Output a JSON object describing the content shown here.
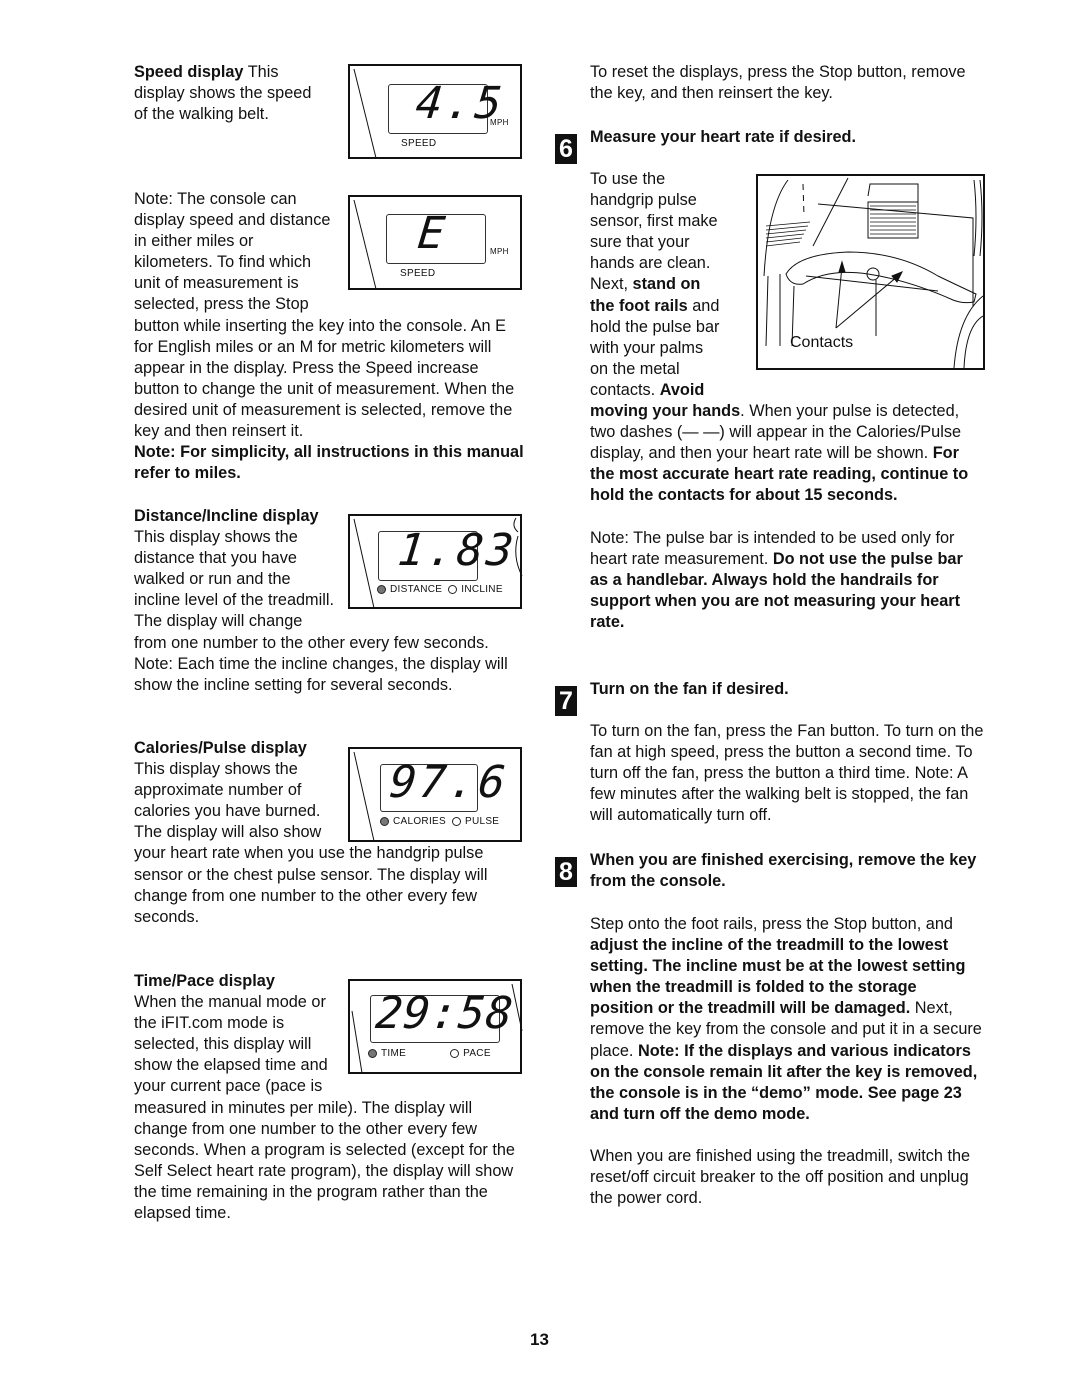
{
  "left_column": {
    "speed": {
      "title": "Speed display",
      "body": " This display shows the speed of the walking belt.",
      "display_value": "4.5",
      "display_unit": "MPH",
      "display_label": "SPEED"
    },
    "units_note": {
      "text": "Note: The console can display speed and distance in either miles or kilometers. To find which unit of measurement is selected, press the Stop button while inserting the key into the console. An  E  for English miles or an  M  for metric kilometers will appear in the display. Press the Speed increase button to change the unit of measurement. When the desired unit of measurement is selected, remove the key and then reinsert it.",
      "bold_text": "Note: For simplicity, all instructions in this manual refer to miles.",
      "display_value": "E",
      "display_unit": "MPH",
      "display_label": "SPEED"
    },
    "distance": {
      "title": "Distance/Incline display",
      "body": " This display shows the distance that you have walked or run and the incline level of the treadmill. The display will change from one number to the other every few seconds. Note: Each time the incline changes, the display will show the incline setting for several seconds.",
      "display_value": "1.83",
      "indicator_on": "DISTANCE",
      "indicator_off": "INCLINE"
    },
    "calories": {
      "title": "Calories/Pulse display",
      "body": " This display shows the approximate number of calories you have burned. The display will also show your heart rate when you use the handgrip pulse sensor or the chest pulse sensor. The display will change from one number to the other every few seconds.",
      "display_value": "97.6",
      "indicator_on": "CALORIES",
      "indicator_off": "PULSE"
    },
    "time": {
      "title": "Time/Pace display",
      "body": "When the manual mode or the iFIT.com mode is selected, this display will show the elapsed time and your current pace (pace is measured in minutes per mile). The display will change from one number to the other every few seconds. When a program is selected (except for the Self Select heart rate program), the display will show the time remaining in the program rather than the elapsed time.",
      "display_value": "29:58",
      "indicator_on": "TIME",
      "indicator_off": "PACE"
    }
  },
  "right_column": {
    "reset_text": "To reset the displays, press the Stop button, remove the key, and then reinsert the key.",
    "step6": {
      "number": "6",
      "title": "Measure your heart rate if desired.",
      "p1_a": "To use the handgrip pulse sensor, first make sure that your hands are clean. Next, ",
      "p1_b": "stand on the foot rails",
      "p1_c": " and hold the pulse bar with your palms on the metal contacts. ",
      "p1_d": "Avoid moving your hands",
      "p1_e": ". When your pulse is detected, two dashes (— —) will appear in the Calories/Pulse display, and then your heart rate will be shown. ",
      "p1_f": "For the most accurate heart rate reading, continue to hold the contacts for about 15 seconds.",
      "p2_a": "Note: The pulse bar is intended to be used only for heart rate measurement. ",
      "p2_b": "Do not use the pulse bar as a handlebar. Always hold the handrails for support when you are not measuring your heart rate.",
      "figure_label": "Contacts"
    },
    "step7": {
      "number": "7",
      "title": "Turn on the fan if desired.",
      "body": "To turn on the fan, press the Fan button. To turn on the fan at high speed, press the button a second time. To turn off the fan, press the button a third time. Note: A few minutes after the walking belt is stopped, the fan will automatically turn off."
    },
    "step8": {
      "number": "8",
      "title": "When you are finished exercising, remove the key from the console.",
      "p1_a": "Step onto the foot rails, press the Stop button, and ",
      "p1_b": "adjust the incline of the treadmill to the lowest setting. The incline must be at the lowest setting when the treadmill is folded to the storage position or the treadmill will be damaged.",
      "p1_c": " Next, remove the key from the console and put it in a secure place. ",
      "p1_d": "Note: If the displays and various indicators on the console remain lit after the key is removed, the console is in the “demo” mode. See page 23 and turn off the demo mode.",
      "p2": "When you are finished using the treadmill, switch the reset/off circuit breaker to the off position and unplug the power cord."
    }
  },
  "page_number": "13"
}
